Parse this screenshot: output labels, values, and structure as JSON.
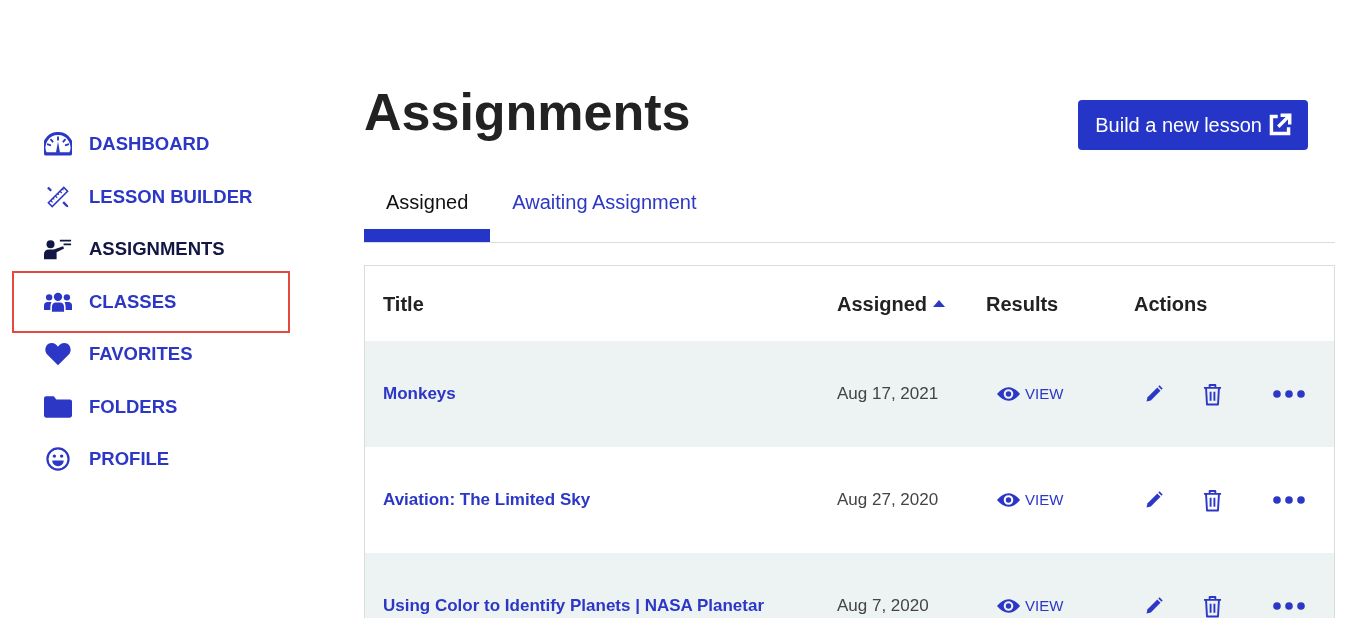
{
  "sidebar": {
    "items": [
      {
        "label": "DASHBOARD",
        "selected": false,
        "highlighted": false
      },
      {
        "label": "LESSON BUILDER",
        "selected": false,
        "highlighted": false
      },
      {
        "label": "ASSIGNMENTS",
        "selected": true,
        "highlighted": false
      },
      {
        "label": "CLASSES",
        "selected": false,
        "highlighted": true
      },
      {
        "label": "FAVORITES",
        "selected": false,
        "highlighted": false
      },
      {
        "label": "FOLDERS",
        "selected": false,
        "highlighted": false
      },
      {
        "label": "PROFILE",
        "selected": false,
        "highlighted": false
      }
    ]
  },
  "header": {
    "title": "Assignments",
    "new_lesson_button": "Build a new lesson"
  },
  "tabs": [
    {
      "label": "Assigned",
      "selected": true
    },
    {
      "label": "Awaiting Assignment",
      "selected": false
    }
  ],
  "table": {
    "columns": [
      {
        "label": "Title",
        "sorted": false
      },
      {
        "label": "Assigned",
        "sorted": true,
        "descending": false
      },
      {
        "label": "Results",
        "sorted": false
      },
      {
        "label": "Actions",
        "sorted": false
      }
    ],
    "rows": [
      {
        "title": "Monkeys",
        "assigned": "Aug 17, 2021",
        "results": "VIEW"
      },
      {
        "title": "Aviation: The Limited Sky",
        "assigned": "Aug 27, 2020",
        "results": "VIEW"
      },
      {
        "title": "Using Color to Identify Planets | NASA Planetar",
        "assigned": "Aug 7, 2020",
        "results": "VIEW"
      }
    ]
  }
}
